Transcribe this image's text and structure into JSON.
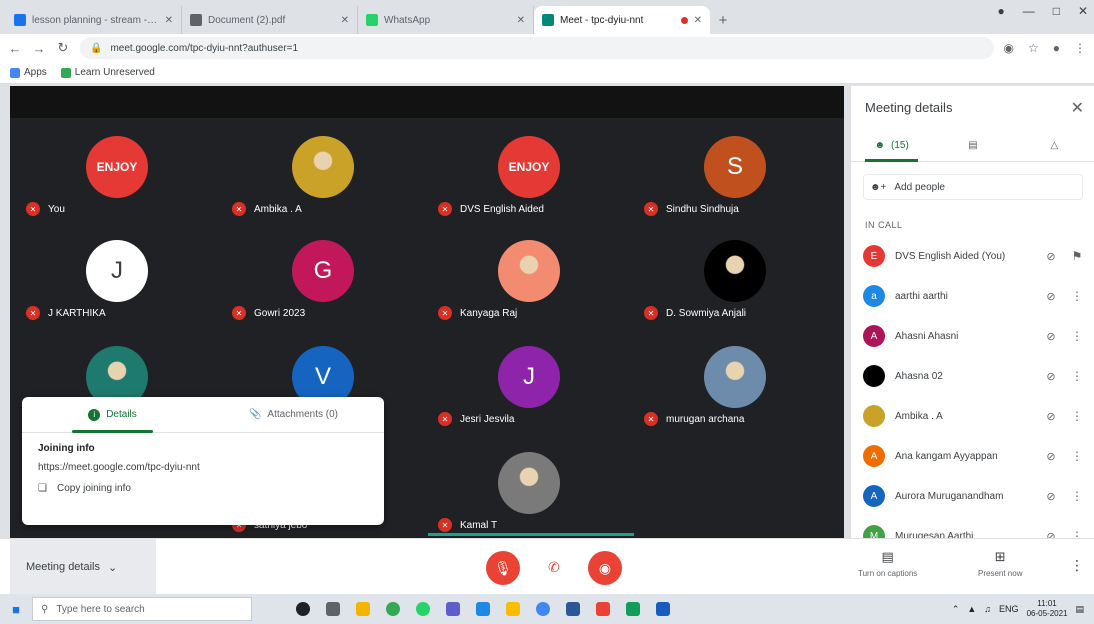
{
  "browser": {
    "tabs": [
      {
        "title": "lesson planning - stream - ucl",
        "favicon_color": "#1a73e8",
        "active": false
      },
      {
        "title": "Document (2).pdf",
        "favicon_color": "#5f6368",
        "active": false
      },
      {
        "title": "WhatsApp",
        "favicon_color": "#25d366",
        "active": false
      },
      {
        "title": "Meet - tpc-dyiu-nnt",
        "favicon_color": "#00897b",
        "active": true
      }
    ],
    "new_tab": "+",
    "url": "meet.google.com/tpc-dyiu-nnt?authuser=1",
    "bookmarks": [
      "Apps",
      "Learn Unreserved"
    ]
  },
  "meet": {
    "tiles": [
      {
        "name": "You",
        "avatar_text": "ENJOY",
        "color": "#e53935",
        "style": "logo"
      },
      {
        "name": "Ambika . A",
        "avatar_text": "",
        "color": "#c9a227",
        "style": "photo"
      },
      {
        "name": "DVS English Aided",
        "avatar_text": "ENJOY",
        "color": "#e53935",
        "style": "logo"
      },
      {
        "name": "Sindhu Sindhuja",
        "avatar_text": "S",
        "color": "#c0501e",
        "style": "letter"
      },
      {
        "name": "J KARTHIKA",
        "avatar_text": "J",
        "color": "#ffffff",
        "style": "letter-dark"
      },
      {
        "name": "Gowri 2023",
        "avatar_text": "G",
        "color": "#c2185b",
        "style": "letter"
      },
      {
        "name": "Kanyaga Raj",
        "avatar_text": "",
        "color": "#f28b6f",
        "style": "photo"
      },
      {
        "name": "D. Sowmiya Anjali",
        "avatar_text": "",
        "color": "#000000",
        "style": "photo"
      },
      {
        "name": "",
        "avatar_text": "",
        "color": "#1e7a6e",
        "style": "photo"
      },
      {
        "name": "",
        "avatar_text": "V",
        "color": "#1565c0",
        "style": "letter"
      },
      {
        "name": "Jesri Jesvila",
        "avatar_text": "J",
        "color": "#8e24aa",
        "style": "letter"
      },
      {
        "name": "murugan archana",
        "avatar_text": "",
        "color": "#6d8cab",
        "style": "photo"
      },
      {
        "name": "",
        "avatar_text": "",
        "color": "#4a7a3a",
        "style": "photo"
      },
      {
        "name": "sathiya jebo",
        "avatar_text": "",
        "color": "#6a7f5a",
        "style": "photo"
      },
      {
        "name": "Kamal T",
        "avatar_text": "",
        "color": "#7a7a7a",
        "style": "photo"
      }
    ],
    "details_card": {
      "tab_details": "Details",
      "tab_attachments": "Attachments (0)",
      "joining_heading": "Joining info",
      "joining_url": "https://meet.google.com/tpc-dyiu-nnt",
      "copy_label": "Copy joining info"
    }
  },
  "panel": {
    "title": "Meeting details",
    "tab_people_count": "(15)",
    "add_people": "Add people",
    "in_call": "IN CALL",
    "participants": [
      {
        "name": "DVS English Aided (You)",
        "color": "#e53935",
        "initial": "E"
      },
      {
        "name": "aarthi aarthi",
        "color": "#1e88e5",
        "initial": "a"
      },
      {
        "name": "Ahasni Ahasni",
        "color": "#ad1457",
        "initial": "A"
      },
      {
        "name": "Ahasna 02",
        "color": "#000000",
        "initial": ""
      },
      {
        "name": "Ambika . A",
        "color": "#c9a227",
        "initial": ""
      },
      {
        "name": "Ana kangam Ayyappan",
        "color": "#ef6c00",
        "initial": "A"
      },
      {
        "name": "Aurora Muruganandham",
        "color": "#1565c0",
        "initial": "A"
      },
      {
        "name": "Murugesan Aarthi",
        "color": "#43a047",
        "initial": "M"
      }
    ]
  },
  "bottom": {
    "meeting_details": "Meeting details",
    "captions_label": "Turn on captions",
    "present_label": "Present now"
  },
  "taskbar": {
    "search_placeholder": "Type here to search",
    "time": "11:01",
    "date": "06-05-2021",
    "lang": "ENG"
  }
}
